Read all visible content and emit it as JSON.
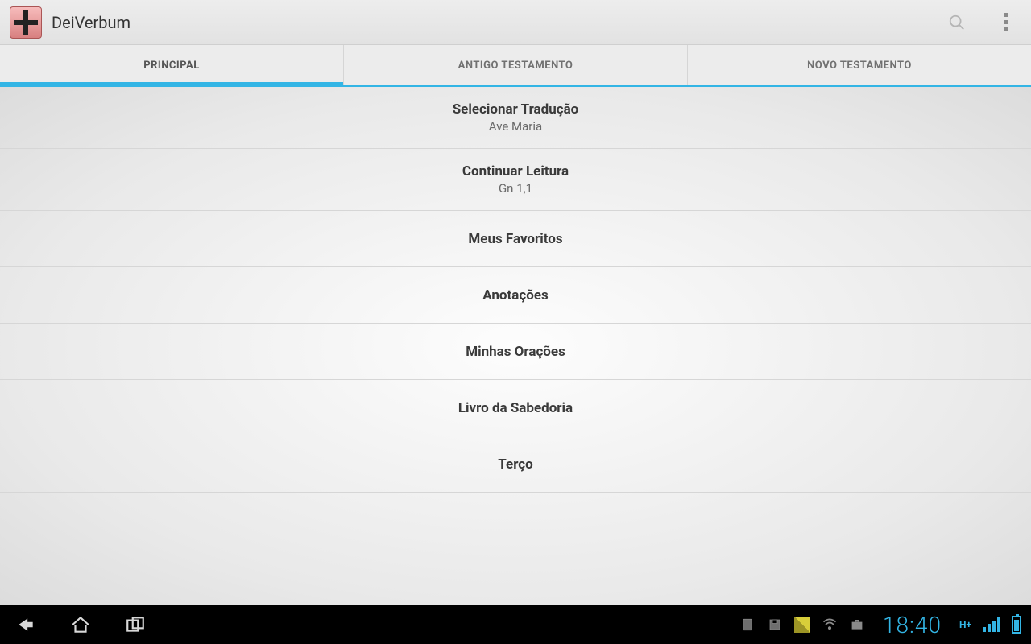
{
  "app": {
    "title": "DeiVerbum"
  },
  "tabs": [
    {
      "label": "PRINCIPAL",
      "active": true
    },
    {
      "label": "ANTIGO TESTAMENTO",
      "active": false
    },
    {
      "label": "NOVO TESTAMENTO",
      "active": false
    }
  ],
  "menu": [
    {
      "title": "Selecionar Tradução",
      "subtitle": "Ave Maria"
    },
    {
      "title": "Continuar Leitura",
      "subtitle": "Gn 1,1"
    },
    {
      "title": "Meus Favoritos"
    },
    {
      "title": "Anotações"
    },
    {
      "title": "Minhas Orações"
    },
    {
      "title": "Livro da Sabedoria"
    },
    {
      "title": "Terço"
    }
  ],
  "status": {
    "clock": "18:40",
    "network_label": "H+"
  }
}
